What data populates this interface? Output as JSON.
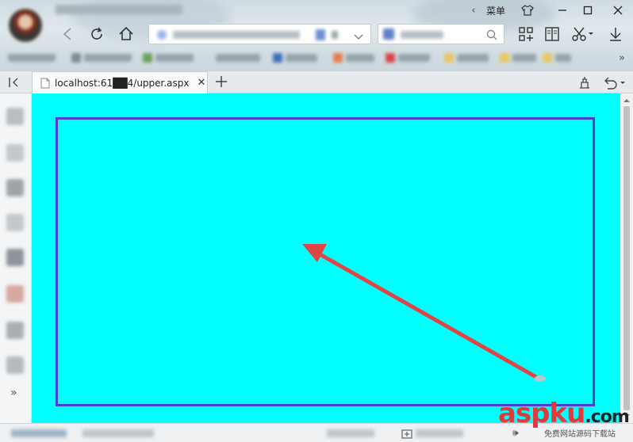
{
  "toolbar": {
    "menu_label": "菜单"
  },
  "tabs": [
    {
      "label": "localhost:61██4/upper.aspx",
      "active": true
    }
  ],
  "colors": {
    "page_background": "#00ffff",
    "frame_border": "#4d3fd8",
    "arrow": "#e04444"
  },
  "icons": {
    "back": "chevron-left-icon",
    "refresh": "refresh-icon",
    "home": "home-icon",
    "apps": "apps-grid-icon",
    "reader": "book-icon",
    "screenshot": "scissors-icon",
    "download": "download-icon",
    "undo": "undo-icon",
    "new_tab": "plus-icon",
    "close_tab": "close-icon",
    "sidebar_toggle": "sidebar-toggle-icon",
    "more": "double-chevron-icon"
  },
  "watermark": {
    "brand": "aspku",
    "tld": ".com",
    "sub": "免费网站源码下载站"
  }
}
